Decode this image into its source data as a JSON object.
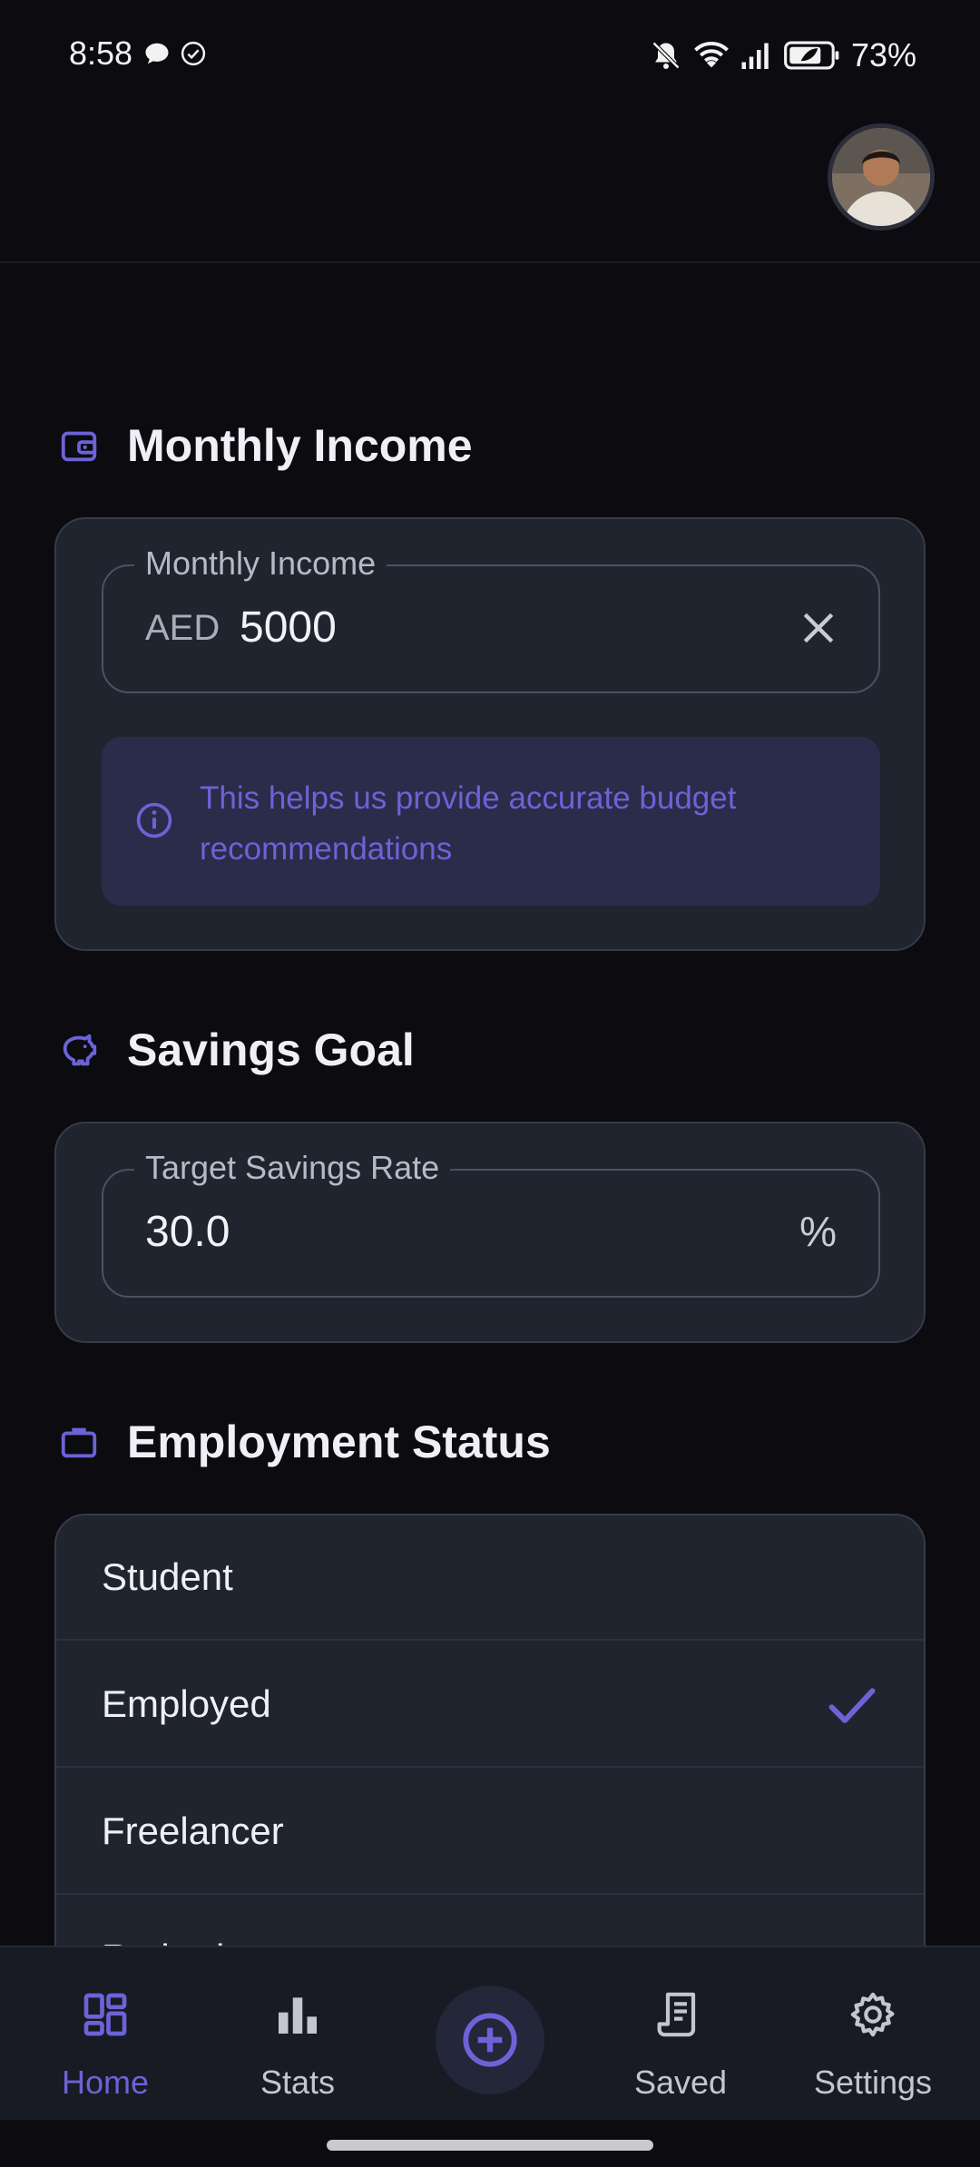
{
  "status_bar": {
    "time": "8:58",
    "battery": "73%"
  },
  "header": {
    "avatar_alt": "profile"
  },
  "income_section": {
    "title": "Monthly Income",
    "field_label": "Monthly Income",
    "currency": "AED",
    "value": "5000",
    "info_text": "This helps us provide accurate budget recommendations"
  },
  "savings_section": {
    "title": "Savings Goal",
    "field_label": "Target Savings Rate",
    "value": "30.0",
    "suffix": "%"
  },
  "employment_section": {
    "title": "Employment Status",
    "options": [
      {
        "label": "Student",
        "selected": false
      },
      {
        "label": "Employed",
        "selected": true
      },
      {
        "label": "Freelancer",
        "selected": false
      },
      {
        "label": "Retired",
        "selected": false
      }
    ]
  },
  "bottom_nav": {
    "home": "Home",
    "stats": "Stats",
    "saved": "Saved",
    "settings": "Settings"
  },
  "colors": {
    "accent": "#6b63d6",
    "background": "#0b0b10",
    "card": "#20242e"
  }
}
